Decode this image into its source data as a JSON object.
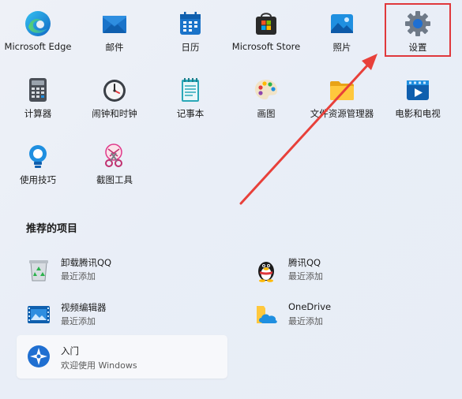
{
  "pinned_apps": [
    {
      "label": "Microsoft Edge",
      "icon": "edge-icon"
    },
    {
      "label": "邮件",
      "icon": "mail-icon"
    },
    {
      "label": "日历",
      "icon": "calendar-icon"
    },
    {
      "label": "Microsoft Store",
      "icon": "store-icon"
    },
    {
      "label": "照片",
      "icon": "photos-icon"
    },
    {
      "label": "设置",
      "icon": "gear-icon"
    },
    {
      "label": "计算器",
      "icon": "calculator-icon"
    },
    {
      "label": "闹钟和时钟",
      "icon": "clock-icon"
    },
    {
      "label": "记事本",
      "icon": "notepad-icon"
    },
    {
      "label": "画图",
      "icon": "paint-icon"
    },
    {
      "label": "文件资源管理器",
      "icon": "folder-icon"
    },
    {
      "label": "电影和电视",
      "icon": "movies-icon"
    },
    {
      "label": "使用技巧",
      "icon": "tips-icon"
    },
    {
      "label": "截图工具",
      "icon": "snipping-tool-icon"
    }
  ],
  "recommended": {
    "title": "推荐的项目",
    "items": [
      {
        "name": "卸载腾讯QQ",
        "sub": "最近添加",
        "icon": "recycle-bin-icon"
      },
      {
        "name": "腾讯QQ",
        "sub": "最近添加",
        "icon": "qq-penguin-icon"
      },
      {
        "name": "视频编辑器",
        "sub": "最近添加",
        "icon": "video-editor-icon"
      },
      {
        "name": "OneDrive",
        "sub": "最近添加",
        "icon": "onedrive-icon"
      },
      {
        "name": "入门",
        "sub": "欢迎使用 Windows",
        "icon": "get-started-icon"
      }
    ]
  },
  "colors": {
    "highlight": "#e0383c",
    "arrow": "#e8403a",
    "accent": "#0078d4"
  }
}
